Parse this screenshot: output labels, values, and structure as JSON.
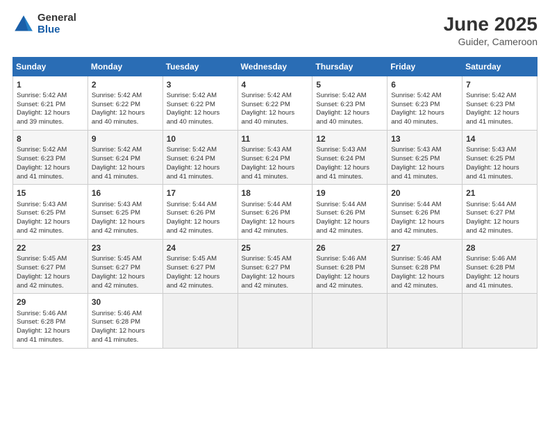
{
  "logo": {
    "general": "General",
    "blue": "Blue"
  },
  "title": "June 2025",
  "subtitle": "Guider, Cameroon",
  "weekdays": [
    "Sunday",
    "Monday",
    "Tuesday",
    "Wednesday",
    "Thursday",
    "Friday",
    "Saturday"
  ],
  "weeks": [
    [
      {
        "day": "1",
        "info": "Sunrise: 5:42 AM\nSunset: 6:21 PM\nDaylight: 12 hours\nand 39 minutes."
      },
      {
        "day": "2",
        "info": "Sunrise: 5:42 AM\nSunset: 6:22 PM\nDaylight: 12 hours\nand 40 minutes."
      },
      {
        "day": "3",
        "info": "Sunrise: 5:42 AM\nSunset: 6:22 PM\nDaylight: 12 hours\nand 40 minutes."
      },
      {
        "day": "4",
        "info": "Sunrise: 5:42 AM\nSunset: 6:22 PM\nDaylight: 12 hours\nand 40 minutes."
      },
      {
        "day": "5",
        "info": "Sunrise: 5:42 AM\nSunset: 6:23 PM\nDaylight: 12 hours\nand 40 minutes."
      },
      {
        "day": "6",
        "info": "Sunrise: 5:42 AM\nSunset: 6:23 PM\nDaylight: 12 hours\nand 40 minutes."
      },
      {
        "day": "7",
        "info": "Sunrise: 5:42 AM\nSunset: 6:23 PM\nDaylight: 12 hours\nand 41 minutes."
      }
    ],
    [
      {
        "day": "8",
        "info": "Sunrise: 5:42 AM\nSunset: 6:23 PM\nDaylight: 12 hours\nand 41 minutes."
      },
      {
        "day": "9",
        "info": "Sunrise: 5:42 AM\nSunset: 6:24 PM\nDaylight: 12 hours\nand 41 minutes."
      },
      {
        "day": "10",
        "info": "Sunrise: 5:42 AM\nSunset: 6:24 PM\nDaylight: 12 hours\nand 41 minutes."
      },
      {
        "day": "11",
        "info": "Sunrise: 5:43 AM\nSunset: 6:24 PM\nDaylight: 12 hours\nand 41 minutes."
      },
      {
        "day": "12",
        "info": "Sunrise: 5:43 AM\nSunset: 6:24 PM\nDaylight: 12 hours\nand 41 minutes."
      },
      {
        "day": "13",
        "info": "Sunrise: 5:43 AM\nSunset: 6:25 PM\nDaylight: 12 hours\nand 41 minutes."
      },
      {
        "day": "14",
        "info": "Sunrise: 5:43 AM\nSunset: 6:25 PM\nDaylight: 12 hours\nand 41 minutes."
      }
    ],
    [
      {
        "day": "15",
        "info": "Sunrise: 5:43 AM\nSunset: 6:25 PM\nDaylight: 12 hours\nand 42 minutes."
      },
      {
        "day": "16",
        "info": "Sunrise: 5:43 AM\nSunset: 6:25 PM\nDaylight: 12 hours\nand 42 minutes."
      },
      {
        "day": "17",
        "info": "Sunrise: 5:44 AM\nSunset: 6:26 PM\nDaylight: 12 hours\nand 42 minutes."
      },
      {
        "day": "18",
        "info": "Sunrise: 5:44 AM\nSunset: 6:26 PM\nDaylight: 12 hours\nand 42 minutes."
      },
      {
        "day": "19",
        "info": "Sunrise: 5:44 AM\nSunset: 6:26 PM\nDaylight: 12 hours\nand 42 minutes."
      },
      {
        "day": "20",
        "info": "Sunrise: 5:44 AM\nSunset: 6:26 PM\nDaylight: 12 hours\nand 42 minutes."
      },
      {
        "day": "21",
        "info": "Sunrise: 5:44 AM\nSunset: 6:27 PM\nDaylight: 12 hours\nand 42 minutes."
      }
    ],
    [
      {
        "day": "22",
        "info": "Sunrise: 5:45 AM\nSunset: 6:27 PM\nDaylight: 12 hours\nand 42 minutes."
      },
      {
        "day": "23",
        "info": "Sunrise: 5:45 AM\nSunset: 6:27 PM\nDaylight: 12 hours\nand 42 minutes."
      },
      {
        "day": "24",
        "info": "Sunrise: 5:45 AM\nSunset: 6:27 PM\nDaylight: 12 hours\nand 42 minutes."
      },
      {
        "day": "25",
        "info": "Sunrise: 5:45 AM\nSunset: 6:27 PM\nDaylight: 12 hours\nand 42 minutes."
      },
      {
        "day": "26",
        "info": "Sunrise: 5:46 AM\nSunset: 6:28 PM\nDaylight: 12 hours\nand 42 minutes."
      },
      {
        "day": "27",
        "info": "Sunrise: 5:46 AM\nSunset: 6:28 PM\nDaylight: 12 hours\nand 42 minutes."
      },
      {
        "day": "28",
        "info": "Sunrise: 5:46 AM\nSunset: 6:28 PM\nDaylight: 12 hours\nand 41 minutes."
      }
    ],
    [
      {
        "day": "29",
        "info": "Sunrise: 5:46 AM\nSunset: 6:28 PM\nDaylight: 12 hours\nand 41 minutes."
      },
      {
        "day": "30",
        "info": "Sunrise: 5:46 AM\nSunset: 6:28 PM\nDaylight: 12 hours\nand 41 minutes."
      },
      {
        "day": "",
        "info": ""
      },
      {
        "day": "",
        "info": ""
      },
      {
        "day": "",
        "info": ""
      },
      {
        "day": "",
        "info": ""
      },
      {
        "day": "",
        "info": ""
      }
    ]
  ]
}
